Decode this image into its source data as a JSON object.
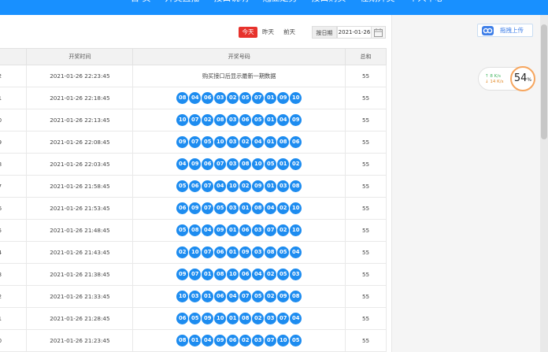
{
  "nav": {
    "items": [
      "首 页",
      "开奖直播",
      "接口说明",
      "冠亚走势",
      "接口购买",
      "往期开奖",
      "个人中心"
    ]
  },
  "filter": {
    "today": "今天",
    "yesterday": "昨天",
    "day_before": "前天",
    "date_label": "按日期",
    "date_value": "2021-01-26"
  },
  "table": {
    "headers": {
      "issue": "",
      "time": "开奖时间",
      "numbers": "开奖号码",
      "sum": "总和"
    },
    "rows": [
      {
        "issue": "2",
        "time": "2021-01-26 22:23:45",
        "note": "购买接口后显示最新一期数据",
        "numbers": [],
        "sum": "55"
      },
      {
        "issue": "1",
        "time": "2021-01-26 22:18:45",
        "numbers": [
          "08",
          "04",
          "06",
          "03",
          "02",
          "05",
          "07",
          "01",
          "09",
          "10"
        ],
        "sum": "55"
      },
      {
        "issue": "0",
        "time": "2021-01-26 22:13:45",
        "numbers": [
          "10",
          "07",
          "02",
          "08",
          "03",
          "06",
          "05",
          "01",
          "04",
          "09"
        ],
        "sum": "55"
      },
      {
        "issue": "9",
        "time": "2021-01-26 22:08:45",
        "numbers": [
          "09",
          "07",
          "05",
          "10",
          "03",
          "02",
          "04",
          "01",
          "08",
          "06"
        ],
        "sum": "55"
      },
      {
        "issue": "8",
        "time": "2021-01-26 22:03:45",
        "numbers": [
          "04",
          "09",
          "06",
          "07",
          "03",
          "08",
          "10",
          "05",
          "01",
          "02"
        ],
        "sum": "55"
      },
      {
        "issue": "7",
        "time": "2021-01-26 21:58:45",
        "numbers": [
          "05",
          "06",
          "07",
          "04",
          "10",
          "02",
          "09",
          "01",
          "03",
          "08"
        ],
        "sum": "55"
      },
      {
        "issue": "6",
        "time": "2021-01-26 21:53:45",
        "numbers": [
          "06",
          "09",
          "07",
          "05",
          "03",
          "01",
          "08",
          "04",
          "02",
          "10"
        ],
        "sum": "55"
      },
      {
        "issue": "5",
        "time": "2021-01-26 21:48:45",
        "numbers": [
          "05",
          "08",
          "04",
          "09",
          "01",
          "06",
          "03",
          "07",
          "02",
          "10"
        ],
        "sum": "55"
      },
      {
        "issue": "4",
        "time": "2021-01-26 21:43:45",
        "numbers": [
          "02",
          "10",
          "07",
          "06",
          "01",
          "09",
          "03",
          "08",
          "05",
          "04"
        ],
        "sum": "55"
      },
      {
        "issue": "3",
        "time": "2021-01-26 21:38:45",
        "numbers": [
          "09",
          "07",
          "01",
          "08",
          "10",
          "06",
          "04",
          "02",
          "05",
          "03"
        ],
        "sum": "55"
      },
      {
        "issue": "2",
        "time": "2021-01-26 21:33:45",
        "numbers": [
          "10",
          "03",
          "01",
          "06",
          "04",
          "07",
          "05",
          "02",
          "09",
          "08"
        ],
        "sum": "55"
      },
      {
        "issue": "1",
        "time": "2021-01-26 21:28:45",
        "numbers": [
          "06",
          "05",
          "09",
          "10",
          "01",
          "08",
          "02",
          "03",
          "07",
          "04"
        ],
        "sum": "55"
      },
      {
        "issue": "0",
        "time": "2021-01-26 21:23:45",
        "numbers": [
          "08",
          "01",
          "04",
          "09",
          "06",
          "02",
          "03",
          "07",
          "10",
          "05"
        ],
        "sum": "55"
      }
    ]
  },
  "sidebar": {
    "upload_label": "拖拽上传",
    "speed_up": "↑ 8 K/s",
    "speed_down": "↓ 14 K/s",
    "gauge_value": "54",
    "gauge_unit": "%"
  },
  "colors": {
    "accent": "#1890ff",
    "ball": "#1d8cf0",
    "today": "#e7322c"
  }
}
